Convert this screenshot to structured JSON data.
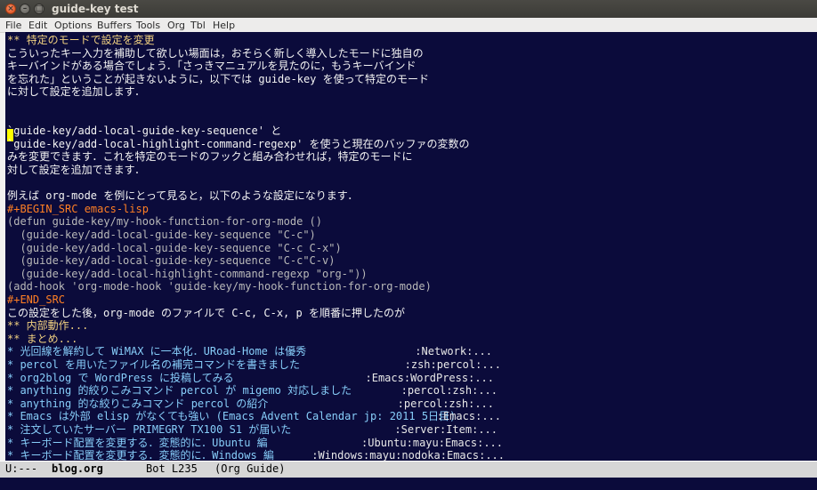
{
  "window": {
    "title": "guide-key test"
  },
  "menubar": [
    "File",
    "Edit",
    "Options",
    "Buffers",
    "Tools",
    "Org",
    "Tbl",
    "Help"
  ],
  "lines": [
    {
      "text": "** 特定のモードで設定を変更",
      "style": "c-head"
    },
    {
      "text": "こういったキー入力を補助して欲しい場面は，おそらく新しく導入したモードに独自の",
      "style": ""
    },
    {
      "text": "キーバインドがある場合でしょう．「さっきマニュアルを見たのに，もうキーバインド",
      "style": ""
    },
    {
      "text": "を忘れた」ということが起きないように，以下では guide-key を使って特定のモード",
      "style": ""
    },
    {
      "text": "に対して設定を追加します．",
      "style": ""
    },
    {
      "text": "",
      "style": ""
    },
    {
      "text": "",
      "style": ""
    },
    {
      "text": "`guide-key/add-local-guide-key-sequence' と",
      "style": ""
    },
    {
      "text": "`guide-key/add-local-highlight-command-regexp' を使うと現在のバッファの変数の",
      "style": ""
    },
    {
      "text": "みを変更できます．これを特定のモードのフックと組み合わせれば，特定のモードに",
      "style": ""
    },
    {
      "text": "対して設定を追加できます．",
      "style": ""
    },
    {
      "text": "",
      "style": ""
    },
    {
      "text": "例えば org-mode を例にとって見ると，以下のような設定になります．",
      "style": ""
    },
    {
      "text": "#+BEGIN_SRC emacs-lisp",
      "style": "c-meta"
    },
    {
      "text": "(defun guide-key/my-hook-function-for-org-mode ()",
      "style": "c-code"
    },
    {
      "text": "  (guide-key/add-local-guide-key-sequence \"C-c\")",
      "style": "c-code"
    },
    {
      "text": "  (guide-key/add-local-guide-key-sequence \"C-c C-x\")",
      "style": "c-code"
    },
    {
      "text": "  (guide-key/add-local-guide-key-sequence \"C-c\"C-v)",
      "style": "c-code"
    },
    {
      "text": "  (guide-key/add-local-highlight-command-regexp \"org-\"))",
      "style": "c-code"
    },
    {
      "text": "(add-hook 'org-mode-hook 'guide-key/my-hook-function-for-org-mode)",
      "style": "c-code"
    },
    {
      "text": "#+END_SRC",
      "style": "c-meta"
    },
    {
      "text": "この設定をした後，org-mode のファイルで C-c, C-x, p を順番に押したのが",
      "style": ""
    },
    {
      "text": "** 内部動作...",
      "style": "c-head"
    },
    {
      "text": "** まとめ...",
      "style": "c-head"
    },
    {
      "text": "* 光回線を解約して WiMAX に一本化．URoad-Home は優秀",
      "style": "c-item",
      "tag": ":Network:..."
    },
    {
      "text": "* percol を用いたファイル名の補完コマンドを書きました",
      "style": "c-item",
      "tag": ":zsh:percol:..."
    },
    {
      "text": "* org2blog で WordPress に投稿してみる",
      "style": "c-item",
      "tag": ":Emacs:WordPress:..."
    },
    {
      "text": "* anything 的絞りこみコマンド percol が migemo 対応しました",
      "style": "c-item",
      "tag": ":percol:zsh:..."
    },
    {
      "text": "* anything 的な絞りこみコマンド percol の紹介",
      "style": "c-item",
      "tag": ":percol:zsh:..."
    },
    {
      "text": "* Emacs は外部 elisp がなくても強い (Emacs Advent Calendar jp: 2011 5日目)",
      "style": "c-item",
      "tag": ":Emacs:..."
    },
    {
      "text": "* 注文していたサーバー PRIMEGRY TX100 S1 が届いた",
      "style": "c-item",
      "tag": ":Server:Item:..."
    },
    {
      "text": "* キーボード配置を変更する．変態的に．Ubuntu 編",
      "style": "c-item",
      "tag": ":Ubuntu:mayu:Emacs:..."
    },
    {
      "text": "* キーボード配置を変更する．変態的に．Windows 編",
      "style": "c-item",
      "tag": ":Windows:mayu:nodoka:Emacs:..."
    }
  ],
  "modeline": {
    "status": "U:---",
    "buffer": "blog.org",
    "position": "Bot L235",
    "mode": "(Org Guide)"
  }
}
